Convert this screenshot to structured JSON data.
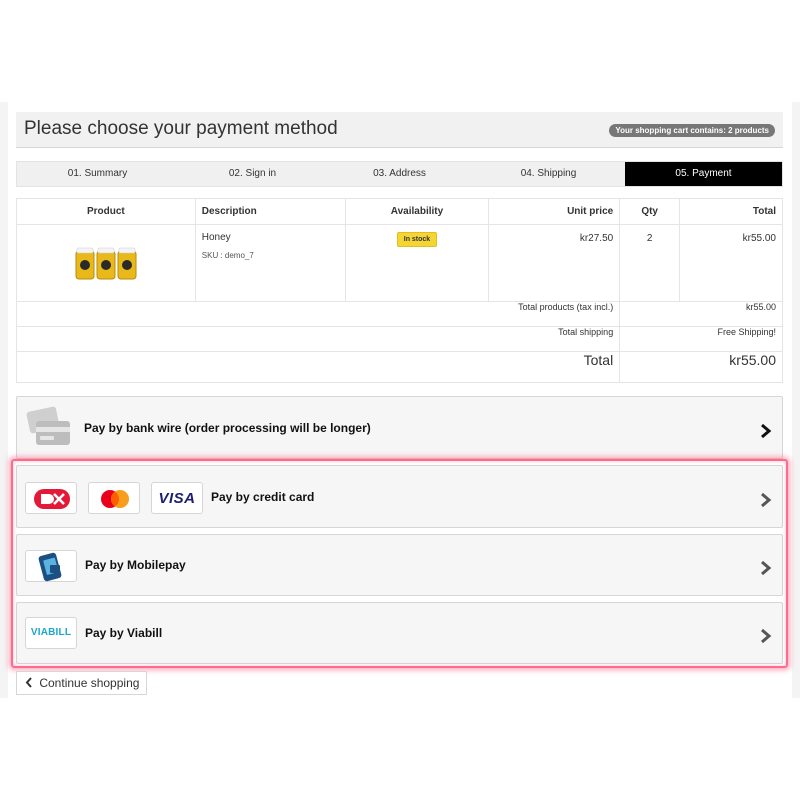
{
  "page": {
    "title": "Please choose your payment method",
    "cart_badge": "Your shopping cart contains: 2 products"
  },
  "steps": [
    {
      "label": "01. Summary",
      "active": false
    },
    {
      "label": "02. Sign in",
      "active": false
    },
    {
      "label": "03. Address",
      "active": false
    },
    {
      "label": "04. Shipping",
      "active": false
    },
    {
      "label": "05. Payment",
      "active": true
    }
  ],
  "table": {
    "headers": {
      "product": "Product",
      "description": "Description",
      "availability": "Availability",
      "unit_price": "Unit price",
      "qty": "Qty",
      "total": "Total"
    },
    "item": {
      "name": "Honey",
      "sku": "SKU : demo_7",
      "availability": "In stock",
      "unit_price": "kr27.50",
      "qty": "2",
      "total": "kr55.00",
      "image_icon": "honey-jars-image"
    },
    "totals": {
      "products_label": "Total products (tax incl.)",
      "products_value": "kr55.00",
      "shipping_label": "Total shipping",
      "shipping_value": "Free Shipping!",
      "grand_label": "Total",
      "grand_value": "kr55.00"
    }
  },
  "payments": {
    "bankwire": {
      "label": "Pay by bank wire (order processing will be longer)",
      "icon": "bank-wire-icon"
    },
    "creditcard": {
      "label": "Pay by credit card",
      "icons": [
        "dankort-icon",
        "mastercard-icon",
        "visa-icon"
      ],
      "visa_text": "VISA"
    },
    "mobilepay": {
      "label": "Pay by Mobilepay",
      "icon": "mobilepay-icon"
    },
    "viabill": {
      "label": "Pay by Viabill",
      "icon": "viabill-icon",
      "logo_text": "VIABILL"
    }
  },
  "continue_shopping": "Continue shopping",
  "colors": {
    "active_step": "#000000",
    "stock_badge": "#f5d533",
    "highlight": "#ff6b8a",
    "dankort_red": "#e31937",
    "mastercard_red": "#eb001b",
    "mastercard_orange": "#f79e1b",
    "visa_blue": "#1a1f71",
    "mobilepay_blue": "#1c4f82",
    "viabill_teal": "#1aa7c9"
  }
}
